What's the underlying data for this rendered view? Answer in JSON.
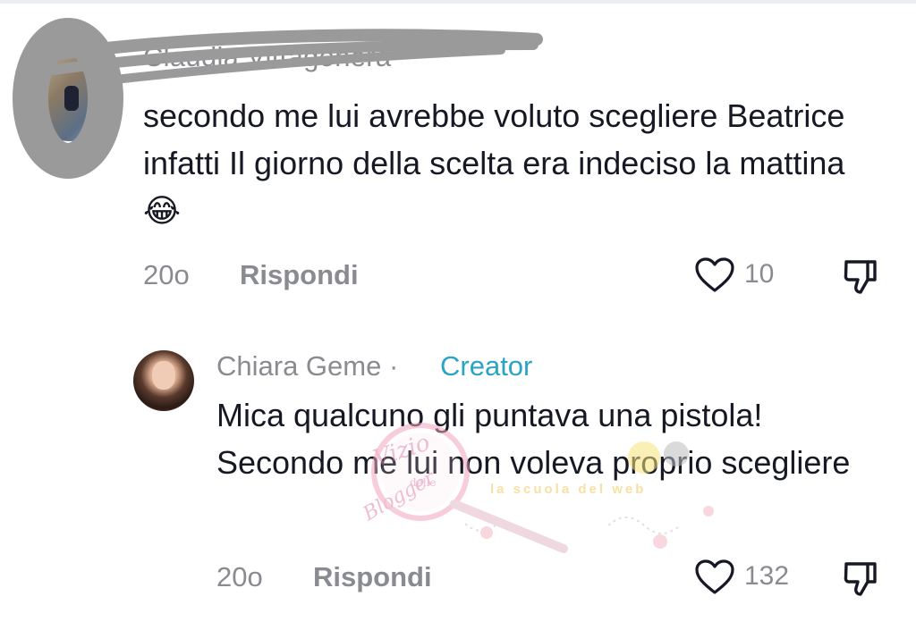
{
  "comments": [
    {
      "username": "Claudia Vittagonera",
      "text": "secondo me lui avrebbe voluto scegliere Beatrice infatti Il giorno della scelta era indeciso la mattina 😂",
      "time": "20o",
      "reply_label": "Rispondi",
      "likes": "10",
      "icons": {
        "like": "heart-outline-icon",
        "dislike": "thumbs-down-icon"
      }
    },
    {
      "username": "Chiara Geme",
      "separator": "·",
      "badge": "Creator",
      "text": "Mica qualcuno gli puntava una pistola! Secondo me lui non voleva proprio scegliere",
      "time": "20o",
      "reply_label": "Rispondi",
      "likes": "132",
      "icons": {
        "like": "heart-outline-icon",
        "dislike": "thumbs-down-icon"
      }
    }
  ],
  "watermark": {
    "line1": "Vizio",
    "line2": "delle",
    "line3": "Blogger",
    "tagline": "la scuola del web"
  },
  "colors": {
    "text": "#161823",
    "muted": "#8a8b91",
    "creator_badge": "#2aa4c4",
    "redaction": "#9a9a9a"
  }
}
